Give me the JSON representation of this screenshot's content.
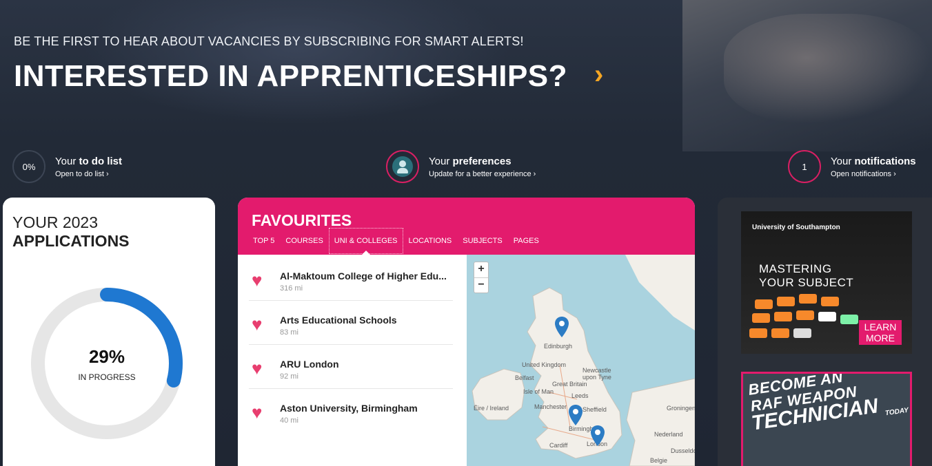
{
  "hero": {
    "subtitle": "BE THE FIRST TO HEAR ABOUT VACANCIES BY SUBSCRIBING FOR SMART ALERTS!",
    "title": "INTERESTED IN APPRENTICESHIPS?",
    "arrow": "›"
  },
  "stats": {
    "todo": {
      "value": "0%",
      "prefix": "Your ",
      "bold": "to do list",
      "link": "Open to do list ›"
    },
    "preferences": {
      "prefix": "Your ",
      "bold": "preferences",
      "link": "Update for a better experience ›"
    },
    "notifications": {
      "value": "1",
      "prefix": "Your ",
      "bold": "notifications",
      "link": "Open notifications ›"
    }
  },
  "applications": {
    "year_label": "YOUR 2023",
    "title": "APPLICATIONS",
    "percent": "29%",
    "progress_fraction": 0.29,
    "status": "IN PROGRESS"
  },
  "favourites": {
    "title": "FAVOURITES",
    "tabs": [
      {
        "label": "TOP 5"
      },
      {
        "label": "COURSES"
      },
      {
        "label": "UNI & COLLEGES"
      },
      {
        "label": "LOCATIONS"
      },
      {
        "label": "SUBJECTS"
      },
      {
        "label": "PAGES"
      }
    ],
    "active_tab": "UNI & COLLEGES",
    "items": [
      {
        "name": "Al-Maktoum College of Higher Edu...",
        "distance": "316 mi"
      },
      {
        "name": "Arts Educational Schools",
        "distance": "83 mi"
      },
      {
        "name": "ARU London",
        "distance": "92 mi"
      },
      {
        "name": "Aston University, Birmingham",
        "distance": "40 mi"
      }
    ],
    "map": {
      "zoom_in": "+",
      "zoom_out": "−",
      "labels": [
        "Edinburgh",
        "United Kingdom",
        "Newcastle upon Tyne",
        "Belfast",
        "Great Britain",
        "Isle of Man",
        "Leeds",
        "Éire / Ireland",
        "Manchester",
        "Sheffield",
        "Birmingham",
        "Cardiff",
        "London",
        "Nederland",
        "Belgie",
        "Dusseldorf",
        "Groningen"
      ]
    }
  },
  "ads": {
    "southampton": {
      "logo": "University of Southampton",
      "headline_1": "MASTERING",
      "headline_2": "YOUR SUBJECT",
      "cta_1": "LEARN",
      "cta_2": "MORE"
    },
    "raf": {
      "line1": "BECOME AN",
      "line2": "RAF WEAPON",
      "line3": "TECHNICIAN",
      "line4": "TODAY"
    }
  },
  "colors": {
    "accent": "#e31b6d",
    "arrow": "#f5a623",
    "progress": "#1f78d1",
    "background": "#1f2633"
  },
  "icons": [
    "chevron-right-icon",
    "person-icon",
    "heart-icon",
    "map-pin-icon",
    "zoom-in-icon",
    "zoom-out-icon"
  ]
}
